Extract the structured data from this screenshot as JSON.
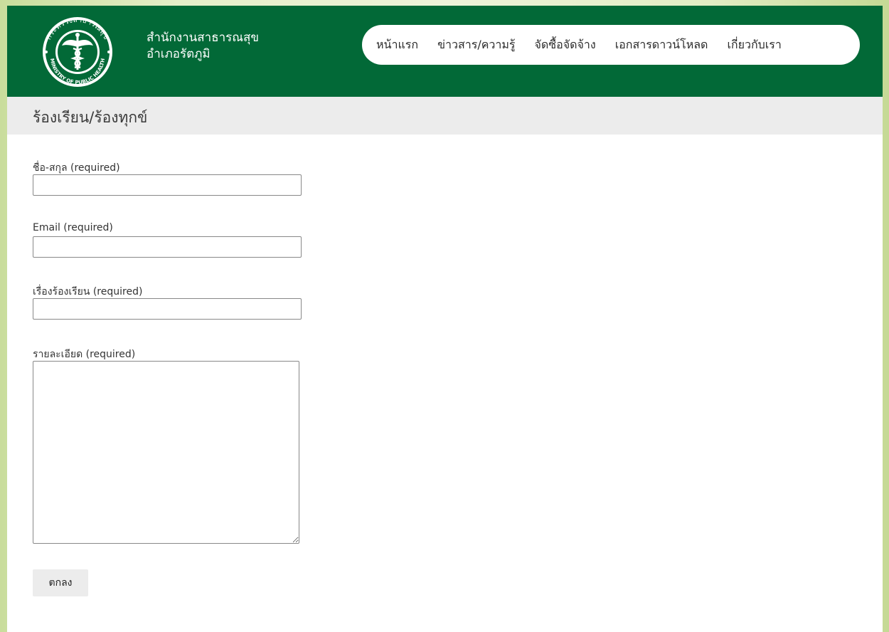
{
  "header": {
    "logo_text_top": "กระทรวงสาธารณสุข",
    "logo_text_bottom": "MINISTRY OF PUBLIC HEALTH",
    "site_title_line1": "สำนักงานสาธารณสุข",
    "site_title_line2": "อำเภอรัตภูมิ",
    "brand_color": "#026937"
  },
  "nav": {
    "items": [
      {
        "label": "หน้าแรก"
      },
      {
        "label": "ข่าวสาร/ความรู้"
      },
      {
        "label": "จัดซื้อจัดจ้าง"
      },
      {
        "label": "เอกสารดาวน์โหลด"
      },
      {
        "label": "เกี่ยวกับเรา"
      }
    ]
  },
  "page": {
    "title": "ร้องเรียน/ร้องทุกข์"
  },
  "form": {
    "name_label": "ชื่อ-สกุล (required)",
    "name_value": "",
    "email_label": "Email (required)",
    "email_value": "",
    "subject_label": "เรื่องร้องเรียน (required)",
    "subject_value": "",
    "details_label": "รายละเอียด (required)",
    "details_value": "",
    "submit_label": "ตกลง"
  }
}
